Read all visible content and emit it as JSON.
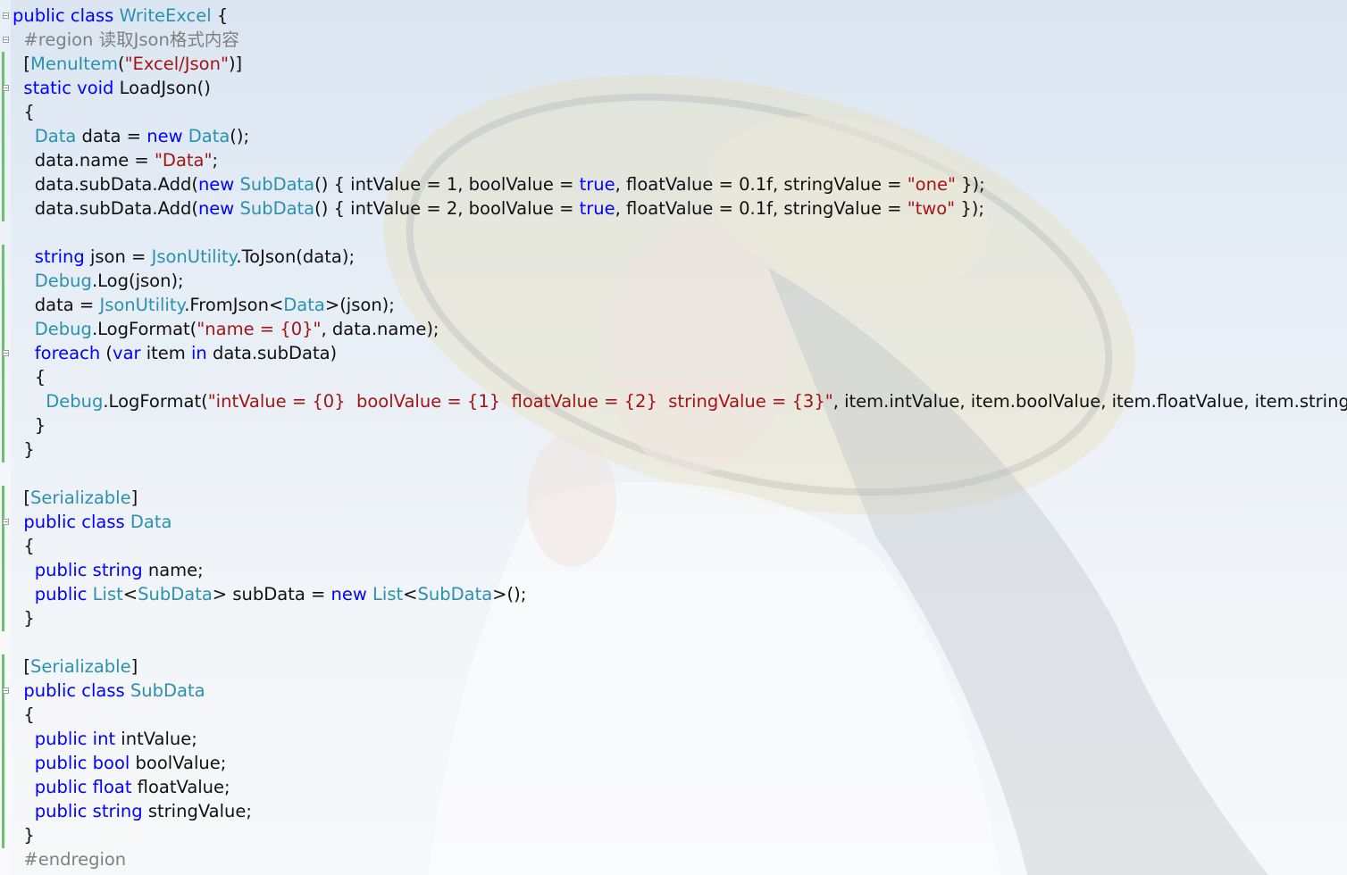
{
  "editor": {
    "language": "csharp",
    "colors": {
      "keyword": "#0000ff",
      "type": "#2b91af",
      "string": "#a31515",
      "preprocessor": "#808080",
      "text": "#111111",
      "change_marker": "#6cc26c"
    },
    "lines": [
      [
        {
          "t": "public",
          "c": "kw"
        },
        {
          "t": " "
        },
        {
          "t": "class",
          "c": "kw"
        },
        {
          "t": " "
        },
        {
          "t": "WriteExcel",
          "c": "type"
        },
        {
          "t": " {"
        }
      ],
      [
        {
          "t": "  "
        },
        {
          "t": "#region 读取Json格式内容",
          "c": "pre"
        }
      ],
      [
        {
          "t": "  ["
        },
        {
          "t": "MenuItem",
          "c": "type"
        },
        {
          "t": "("
        },
        {
          "t": "\"Excel/Json\"",
          "c": "str"
        },
        {
          "t": ")]"
        }
      ],
      [
        {
          "t": "  "
        },
        {
          "t": "static",
          "c": "kw"
        },
        {
          "t": " "
        },
        {
          "t": "void",
          "c": "kw"
        },
        {
          "t": " LoadJson()"
        }
      ],
      [
        {
          "t": "  {"
        }
      ],
      [
        {
          "t": "    "
        },
        {
          "t": "Data",
          "c": "type"
        },
        {
          "t": " data = "
        },
        {
          "t": "new",
          "c": "kw"
        },
        {
          "t": " "
        },
        {
          "t": "Data",
          "c": "type"
        },
        {
          "t": "();"
        }
      ],
      [
        {
          "t": "    data.name = "
        },
        {
          "t": "\"Data\"",
          "c": "str"
        },
        {
          "t": ";"
        }
      ],
      [
        {
          "t": "    data.subData.Add("
        },
        {
          "t": "new",
          "c": "kw"
        },
        {
          "t": " "
        },
        {
          "t": "SubData",
          "c": "type"
        },
        {
          "t": "() { intValue = 1, boolValue = "
        },
        {
          "t": "true",
          "c": "kw"
        },
        {
          "t": ", floatValue = 0.1f, stringValue = "
        },
        {
          "t": "\"one\"",
          "c": "str"
        },
        {
          "t": " });"
        }
      ],
      [
        {
          "t": "    data.subData.Add("
        },
        {
          "t": "new",
          "c": "kw"
        },
        {
          "t": " "
        },
        {
          "t": "SubData",
          "c": "type"
        },
        {
          "t": "() { intValue = 2, boolValue = "
        },
        {
          "t": "true",
          "c": "kw"
        },
        {
          "t": ", floatValue = 0.1f, stringValue = "
        },
        {
          "t": "\"two\"",
          "c": "str"
        },
        {
          "t": " });"
        }
      ],
      [],
      [
        {
          "t": "    "
        },
        {
          "t": "string",
          "c": "kw"
        },
        {
          "t": " json = "
        },
        {
          "t": "JsonUtility",
          "c": "type"
        },
        {
          "t": ".ToJson(data);"
        }
      ],
      [
        {
          "t": "    "
        },
        {
          "t": "Debug",
          "c": "type"
        },
        {
          "t": ".Log(json);"
        }
      ],
      [
        {
          "t": "    data = "
        },
        {
          "t": "JsonUtility",
          "c": "type"
        },
        {
          "t": ".FromJson<"
        },
        {
          "t": "Data",
          "c": "type"
        },
        {
          "t": ">(json);"
        }
      ],
      [
        {
          "t": "    "
        },
        {
          "t": "Debug",
          "c": "type"
        },
        {
          "t": ".LogFormat("
        },
        {
          "t": "\"name = {0}\"",
          "c": "str"
        },
        {
          "t": ", data.name);"
        }
      ],
      [
        {
          "t": "    "
        },
        {
          "t": "foreach",
          "c": "kw"
        },
        {
          "t": " ("
        },
        {
          "t": "var",
          "c": "kw"
        },
        {
          "t": " item "
        },
        {
          "t": "in",
          "c": "kw"
        },
        {
          "t": " data.subData)"
        }
      ],
      [
        {
          "t": "    {"
        }
      ],
      [
        {
          "t": "      "
        },
        {
          "t": "Debug",
          "c": "type"
        },
        {
          "t": ".LogFormat("
        },
        {
          "t": "\"intValue = {0}  boolValue = {1}  floatValue = {2}  stringValue = {3}\"",
          "c": "str"
        },
        {
          "t": ", item.intValue, item.boolValue, item.floatValue, item.stringValue);"
        }
      ],
      [
        {
          "t": "    }"
        }
      ],
      [
        {
          "t": "  }"
        }
      ],
      [],
      [
        {
          "t": "  ["
        },
        {
          "t": "Serializable",
          "c": "type"
        },
        {
          "t": "]"
        }
      ],
      [
        {
          "t": "  "
        },
        {
          "t": "public",
          "c": "kw"
        },
        {
          "t": " "
        },
        {
          "t": "class",
          "c": "kw"
        },
        {
          "t": " "
        },
        {
          "t": "Data",
          "c": "type"
        }
      ],
      [
        {
          "t": "  {"
        }
      ],
      [
        {
          "t": "    "
        },
        {
          "t": "public",
          "c": "kw"
        },
        {
          "t": " "
        },
        {
          "t": "string",
          "c": "kw"
        },
        {
          "t": " name;"
        }
      ],
      [
        {
          "t": "    "
        },
        {
          "t": "public",
          "c": "kw"
        },
        {
          "t": " "
        },
        {
          "t": "List",
          "c": "type"
        },
        {
          "t": "<"
        },
        {
          "t": "SubData",
          "c": "type"
        },
        {
          "t": "> subData = "
        },
        {
          "t": "new",
          "c": "kw"
        },
        {
          "t": " "
        },
        {
          "t": "List",
          "c": "type"
        },
        {
          "t": "<"
        },
        {
          "t": "SubData",
          "c": "type"
        },
        {
          "t": ">();"
        }
      ],
      [
        {
          "t": "  }"
        }
      ],
      [],
      [
        {
          "t": "  ["
        },
        {
          "t": "Serializable",
          "c": "type"
        },
        {
          "t": "]"
        }
      ],
      [
        {
          "t": "  "
        },
        {
          "t": "public",
          "c": "kw"
        },
        {
          "t": " "
        },
        {
          "t": "class",
          "c": "kw"
        },
        {
          "t": " "
        },
        {
          "t": "SubData",
          "c": "type"
        }
      ],
      [
        {
          "t": "  {"
        }
      ],
      [
        {
          "t": "    "
        },
        {
          "t": "public",
          "c": "kw"
        },
        {
          "t": " "
        },
        {
          "t": "int",
          "c": "kw"
        },
        {
          "t": " intValue;"
        }
      ],
      [
        {
          "t": "    "
        },
        {
          "t": "public",
          "c": "kw"
        },
        {
          "t": " "
        },
        {
          "t": "bool",
          "c": "kw"
        },
        {
          "t": " boolValue;"
        }
      ],
      [
        {
          "t": "    "
        },
        {
          "t": "public",
          "c": "kw"
        },
        {
          "t": " "
        },
        {
          "t": "float",
          "c": "kw"
        },
        {
          "t": " floatValue;"
        }
      ],
      [
        {
          "t": "    "
        },
        {
          "t": "public",
          "c": "kw"
        },
        {
          "t": " "
        },
        {
          "t": "string",
          "c": "kw"
        },
        {
          "t": " stringValue;"
        }
      ],
      [
        {
          "t": "  }"
        }
      ],
      [
        {
          "t": "  "
        },
        {
          "t": "#endregion",
          "c": "pre"
        }
      ]
    ]
  }
}
